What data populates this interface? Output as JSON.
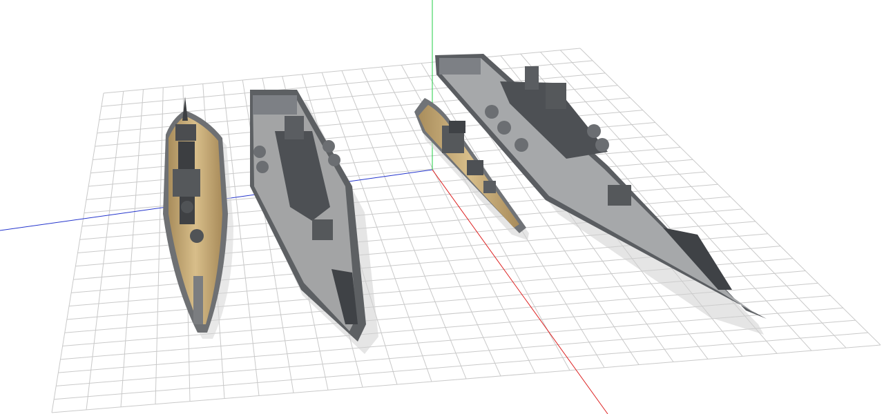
{
  "viewport": {
    "background": "#ffffff",
    "grid": {
      "visible": true,
      "color": "#c9c9c9"
    },
    "axes": {
      "x": {
        "color": "#2233cc"
      },
      "y": {
        "color": "#22cc44"
      },
      "z": {
        "color": "#dd2222"
      }
    }
  },
  "models": [
    {
      "name": "battleship-wood-deck",
      "deck_color": "#c4a877",
      "hull_color": "#6e7073"
    },
    {
      "name": "carrier-battleship-grey",
      "deck_color": "#8c8e90",
      "hull_color": "#5d6063"
    },
    {
      "name": "battleship-small-wood-deck",
      "deck_color": "#d0b37d",
      "hull_color": "#707377"
    },
    {
      "name": "carrier-battleship-large-grey",
      "deck_color": "#8a8c8f",
      "hull_color": "#5a5d61"
    }
  ]
}
